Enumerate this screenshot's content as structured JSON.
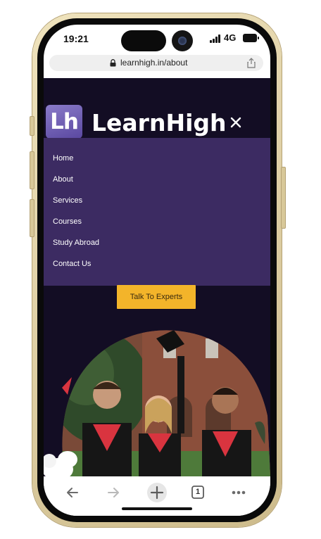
{
  "status_bar": {
    "time": "19:21",
    "network": "4G"
  },
  "browser": {
    "url": "learnhigh.in/about"
  },
  "site": {
    "logo_badge": "Lh",
    "logo_text": "LearnHigh",
    "nav_items": [
      {
        "label": "Home"
      },
      {
        "label": "About"
      },
      {
        "label": "Services"
      },
      {
        "label": "Courses"
      },
      {
        "label": "Study Abroad"
      },
      {
        "label": "Contact Us"
      }
    ],
    "cta_label": "Talk To Experts"
  },
  "toolbar": {
    "tab_count": "1"
  },
  "icons": [
    "lock-icon",
    "share-icon",
    "close-icon",
    "back-arrow-icon",
    "forward-arrow-icon",
    "new-tab-plus-icon",
    "tabs-count-icon",
    "more-options-icon"
  ],
  "colors": {
    "page_background": "#130d24",
    "menu_background": "#3c2b62",
    "cta_background": "#f3b42a",
    "logo_badge": "#6b5bb5"
  }
}
